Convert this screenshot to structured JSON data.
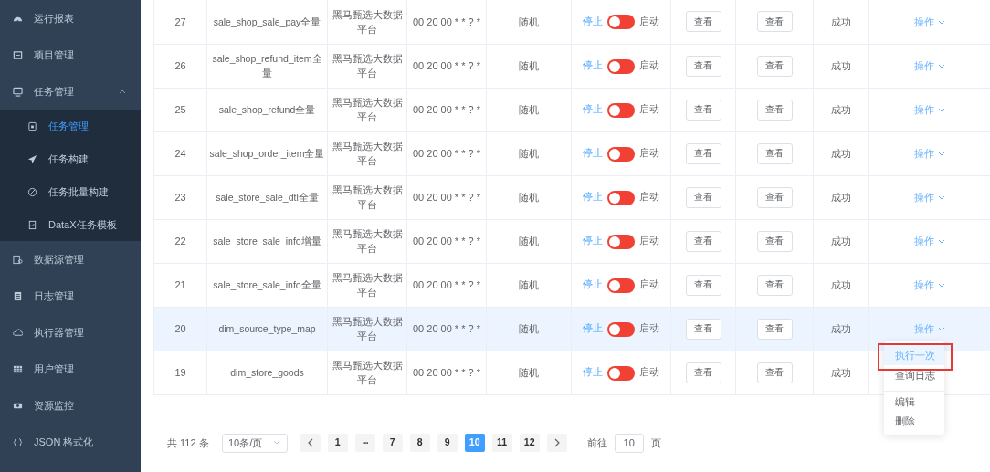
{
  "sidebar": {
    "items": [
      {
        "label": "运行报表",
        "selected": false
      },
      {
        "label": "项目管理",
        "selected": false
      },
      {
        "label": "任务管理",
        "selected": false,
        "expanded": true,
        "children": [
          {
            "label": "任务管理",
            "selected": true
          },
          {
            "label": "任务构建",
            "selected": false
          },
          {
            "label": "任务批量构建",
            "selected": false
          },
          {
            "label": "DataX任务模板",
            "selected": false
          }
        ]
      },
      {
        "label": "数据源管理",
        "selected": false
      },
      {
        "label": "日志管理",
        "selected": false
      },
      {
        "label": "执行器管理",
        "selected": false
      },
      {
        "label": "用户管理",
        "selected": false
      },
      {
        "label": "资源监控",
        "selected": false
      },
      {
        "label": "JSON 格式化",
        "selected": false
      }
    ]
  },
  "table": {
    "rows": [
      {
        "id": "27",
        "name": "sale_shop_sale_pay全量",
        "platform": "黑马甄选大数据平台",
        "cron": "00 20 00 * * ? *",
        "route": "随机",
        "stop_label": "停止",
        "on": false,
        "start_label": "启动",
        "view_1": "查看",
        "view_2": "查看",
        "result": "成功",
        "action": "操作",
        "highlighted": false
      },
      {
        "id": "26",
        "name": "sale_shop_refund_item全量",
        "platform": "黑马甄选大数据平台",
        "cron": "00 20 00 * * ? *",
        "route": "随机",
        "stop_label": "停止",
        "on": false,
        "start_label": "启动",
        "view_1": "查看",
        "view_2": "查看",
        "result": "成功",
        "action": "操作",
        "highlighted": false
      },
      {
        "id": "25",
        "name": "sale_shop_refund全量",
        "platform": "黑马甄选大数据平台",
        "cron": "00 20 00 * * ? *",
        "route": "随机",
        "stop_label": "停止",
        "on": false,
        "start_label": "启动",
        "view_1": "查看",
        "view_2": "查看",
        "result": "成功",
        "action": "操作",
        "highlighted": false
      },
      {
        "id": "24",
        "name": "sale_shop_order_item全量",
        "platform": "黑马甄选大数据平台",
        "cron": "00 20 00 * * ? *",
        "route": "随机",
        "stop_label": "停止",
        "on": false,
        "start_label": "启动",
        "view_1": "查看",
        "view_2": "查看",
        "result": "成功",
        "action": "操作",
        "highlighted": false
      },
      {
        "id": "23",
        "name": "sale_store_sale_dtl全量",
        "platform": "黑马甄选大数据平台",
        "cron": "00 20 00 * * ? *",
        "route": "随机",
        "stop_label": "停止",
        "on": false,
        "start_label": "启动",
        "view_1": "查看",
        "view_2": "查看",
        "result": "成功",
        "action": "操作",
        "highlighted": false
      },
      {
        "id": "22",
        "name": "sale_store_sale_info增量",
        "platform": "黑马甄选大数据平台",
        "cron": "00 20 00 * * ? *",
        "route": "随机",
        "stop_label": "停止",
        "on": false,
        "start_label": "启动",
        "view_1": "查看",
        "view_2": "查看",
        "result": "成功",
        "action": "操作",
        "highlighted": false
      },
      {
        "id": "21",
        "name": "sale_store_sale_info全量",
        "platform": "黑马甄选大数据平台",
        "cron": "00 20 00 * * ? *",
        "route": "随机",
        "stop_label": "停止",
        "on": false,
        "start_label": "启动",
        "view_1": "查看",
        "view_2": "查看",
        "result": "成功",
        "action": "操作",
        "highlighted": false
      },
      {
        "id": "20",
        "name": "dim_source_type_map",
        "platform": "黑马甄选大数据平台",
        "cron": "00 20 00 * * ? *",
        "route": "随机",
        "stop_label": "停止",
        "on": false,
        "start_label": "启动",
        "view_1": "查看",
        "view_2": "查看",
        "result": "成功",
        "action": "操作",
        "highlighted": true
      },
      {
        "id": "19",
        "name": "dim_store_goods",
        "platform": "黑马甄选大数据平台",
        "cron": "00 20 00 * * ? *",
        "route": "随机",
        "stop_label": "停止",
        "on": false,
        "start_label": "启动",
        "view_1": "查看",
        "view_2": "查看",
        "result": "成功",
        "highlighted": false
      }
    ]
  },
  "dropdown": {
    "items": [
      {
        "label": "执行一次",
        "selected": true,
        "framed": true,
        "divided": false
      },
      {
        "label": "查询日志",
        "selected": false,
        "framed": false,
        "divided": false
      },
      {
        "label": "编辑",
        "selected": false,
        "framed": false,
        "divided": true
      },
      {
        "label": "删除",
        "selected": false,
        "framed": false,
        "divided": false
      }
    ]
  },
  "pagination": {
    "total": "共 112 条",
    "page_size": "10条/页",
    "pages": [
      {
        "label": "1",
        "kind": "page",
        "selected": false
      },
      {
        "label": "···",
        "kind": "more",
        "selected": false
      },
      {
        "label": "7",
        "kind": "page",
        "selected": false
      },
      {
        "label": "8",
        "kind": "page",
        "selected": false
      },
      {
        "label": "9",
        "kind": "page",
        "selected": false
      },
      {
        "label": "10",
        "kind": "page",
        "selected": true
      },
      {
        "label": "11",
        "kind": "page",
        "selected": false
      },
      {
        "label": "12",
        "kind": "page",
        "selected": false
      }
    ],
    "goto_label": "前往",
    "goto_value": "10",
    "goto_suffix": "页"
  }
}
